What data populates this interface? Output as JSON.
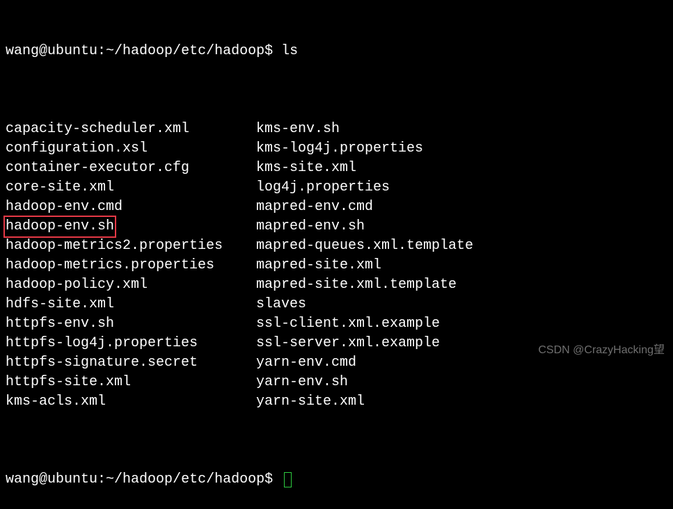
{
  "prompt1": {
    "user_host": "wang@ubuntu",
    "path": "~/hadoop/etc/hadoop",
    "symbol": "$",
    "command": "ls"
  },
  "listing": {
    "col1": [
      "capacity-scheduler.xml",
      "configuration.xsl",
      "container-executor.cfg",
      "core-site.xml",
      "hadoop-env.cmd",
      "hadoop-env.sh",
      "hadoop-metrics2.properties",
      "hadoop-metrics.properties",
      "hadoop-policy.xml",
      "hdfs-site.xml",
      "httpfs-env.sh",
      "httpfs-log4j.properties",
      "httpfs-signature.secret",
      "httpfs-site.xml",
      "kms-acls.xml"
    ],
    "col2": [
      "kms-env.sh",
      "kms-log4j.properties",
      "kms-site.xml",
      "log4j.properties",
      "mapred-env.cmd",
      "mapred-env.sh",
      "mapred-queues.xml.template",
      "mapred-site.xml",
      "mapred-site.xml.template",
      "slaves",
      "ssl-client.xml.example",
      "ssl-server.xml.example",
      "yarn-env.cmd",
      "yarn-env.sh",
      "yarn-site.xml"
    ],
    "highlighted_index": 5
  },
  "prompt2": {
    "user_host": "wang@ubuntu",
    "path": "~/hadoop/etc/hadoop",
    "symbol": "$"
  },
  "watermark": "CSDN @CrazyHacking望"
}
